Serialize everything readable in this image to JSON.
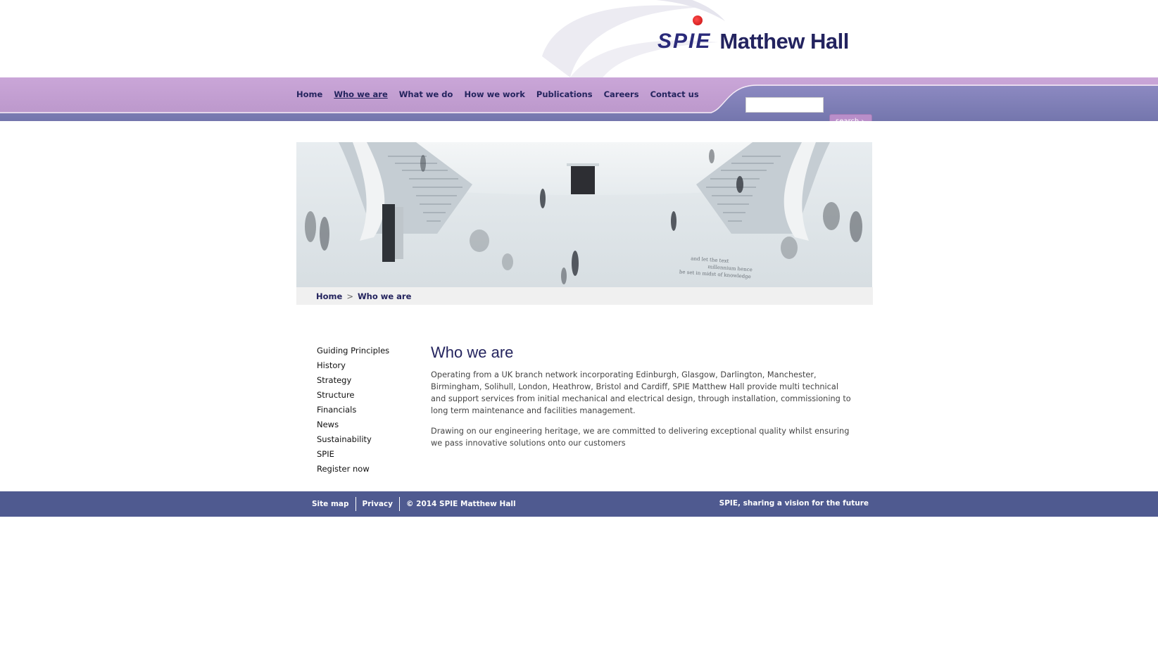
{
  "logo": {
    "brand": "SPIE",
    "name": "Matthew Hall"
  },
  "nav": {
    "items": [
      "Home",
      "Who we are",
      "What we do",
      "How we work",
      "Publications",
      "Careers",
      "Contact us"
    ],
    "active": "Who we are"
  },
  "search": {
    "placeholder": "",
    "button_label": "search"
  },
  "hero": {
    "engraved_text": [
      "and let the text",
      "millennium hence",
      "be set in midst of knowledge"
    ]
  },
  "breadcrumb": {
    "home": "Home",
    "separator": ">",
    "current": "Who we are"
  },
  "sidebar": {
    "items": [
      "Guiding Principles",
      "History",
      "Strategy",
      "Structure",
      "Financials",
      "News",
      "Sustainability",
      "SPIE",
      "Register now"
    ]
  },
  "content": {
    "title": "Who we are",
    "paragraphs": [
      "Operating from a UK branch network incorporating Edinburgh, Glasgow, Darlington, Manchester, Birmingham, Solihull, London, Heathrow, Bristol and Cardiff, SPIE Matthew Hall provide multi technical and support services from initial mechanical and electrical design, through installation, commissioning to long term maintenance and facilities management.",
      "Drawing on our engineering heritage, we are committed to delivering exceptional quality whilst ensuring we pass innovative solutions onto our customers"
    ]
  },
  "footer": {
    "sitemap": "Site map",
    "privacy": "Privacy",
    "copyright": "© 2014 SPIE Matthew Hall",
    "tagline": "SPIE, sharing a vision for the future"
  },
  "colors": {
    "navy": "#24245e",
    "nav_band_light": "#c9a8d6",
    "nav_band_dark": "#7d7db5",
    "footer": "#4f5a90",
    "logo_red": "#d41c1c"
  }
}
